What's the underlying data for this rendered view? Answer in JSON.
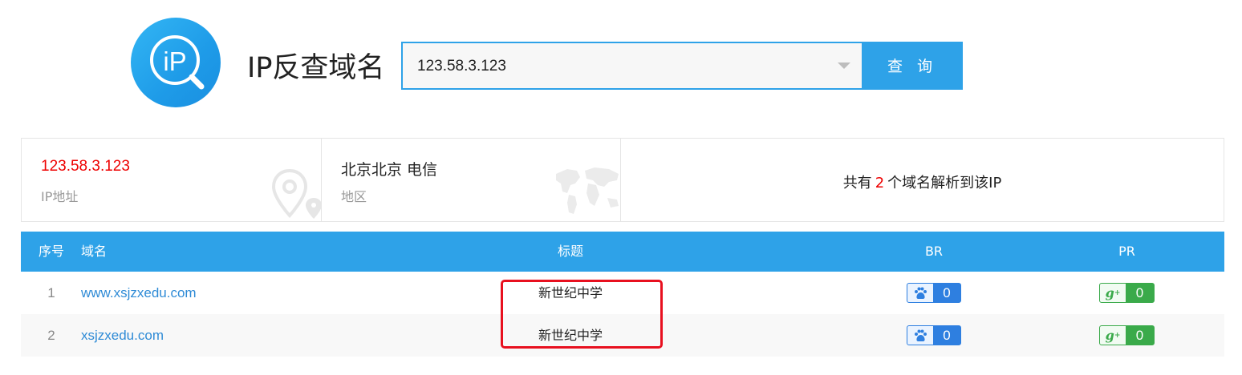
{
  "header": {
    "title": "IP反查域名",
    "logo_text": "iP"
  },
  "search": {
    "value": "123.58.3.123",
    "button_label": "查 询"
  },
  "info": {
    "ip_value": "123.58.3.123",
    "ip_label": "IP地址",
    "region_value": "北京北京 电信",
    "region_label": "地区",
    "count_prefix": "共有",
    "count_value": "2",
    "count_suffix": "个域名解析到该IP"
  },
  "table": {
    "headers": {
      "index": "序号",
      "domain": "域名",
      "title": "标题",
      "br": "BR",
      "pr": "PR"
    },
    "rows": [
      {
        "index": "1",
        "domain": "www.xsjzxedu.com",
        "title": "新世纪中学",
        "br": "0",
        "pr": "0"
      },
      {
        "index": "2",
        "domain": "xsjzxedu.com",
        "title": "新世纪中学",
        "br": "0",
        "pr": "0"
      }
    ]
  },
  "colors": {
    "accent": "#2ea2e8",
    "highlight_box": "#e8101f",
    "ip_red": "#e00000",
    "link_blue": "#2f8bd6",
    "pr_green": "#3aaa4a",
    "br_blue": "#2e7fe0"
  },
  "icons": [
    "ip-search-logo-icon",
    "caret-down-icon",
    "location-pin-icon",
    "world-map-icon",
    "baidu-paw-icon",
    "google-plus-icon"
  ]
}
